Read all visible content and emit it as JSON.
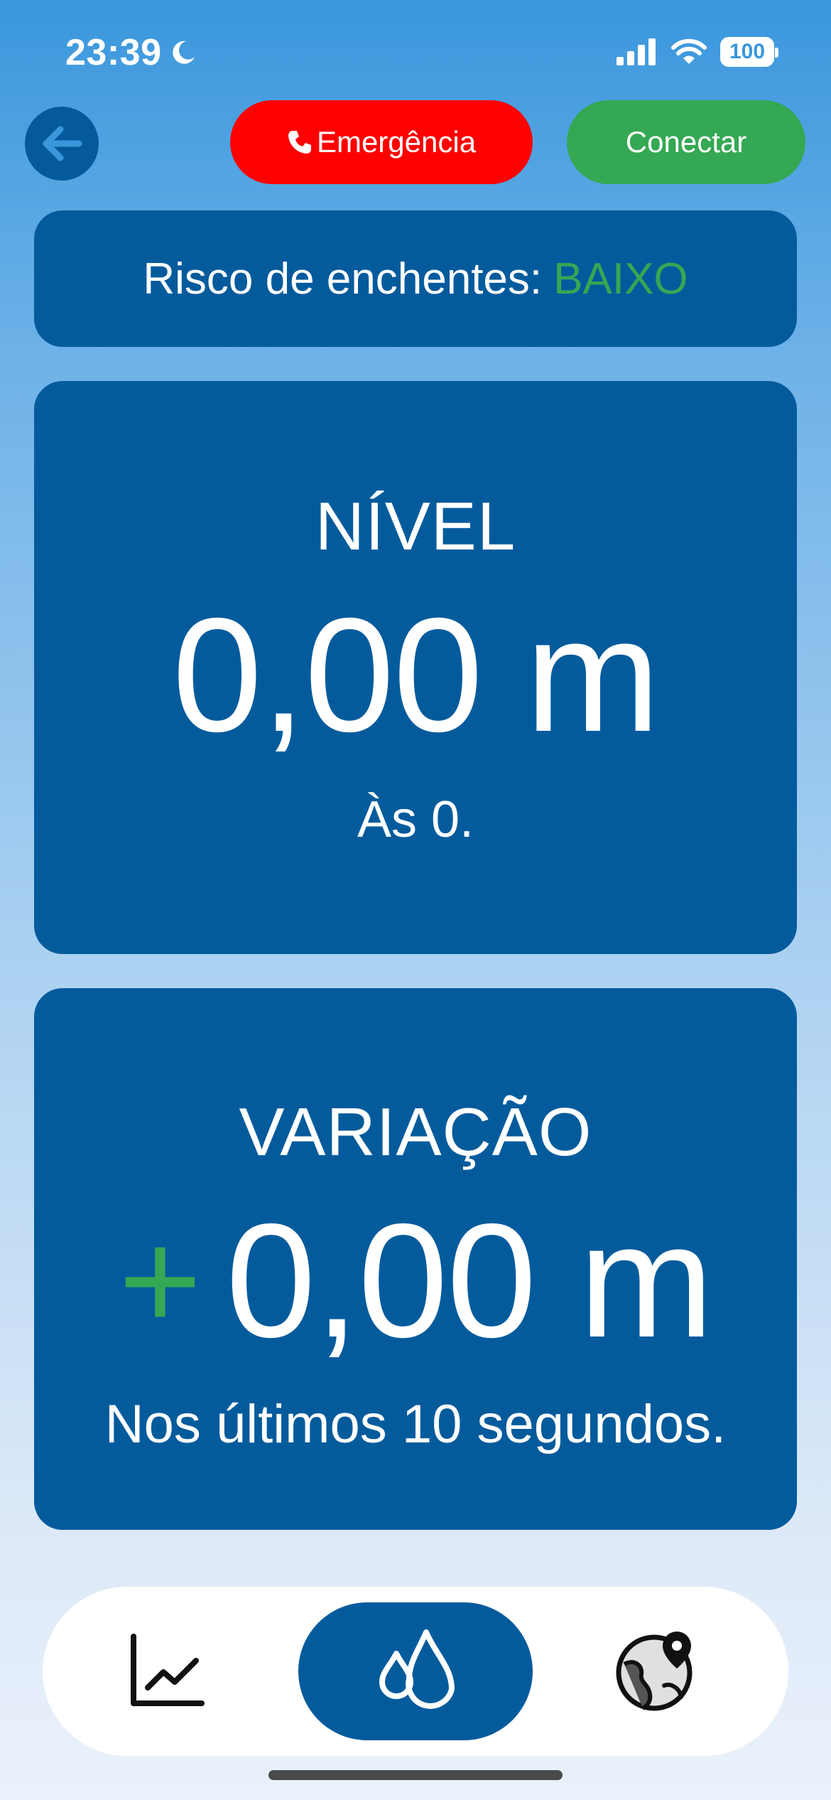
{
  "status_bar": {
    "time": "23:39",
    "battery": "100"
  },
  "header": {
    "back_icon": "arrow-left-icon",
    "emergency_label": "Emergência",
    "emergency_icon": "phone-icon",
    "connect_label": "Conectar"
  },
  "risk": {
    "label": "Risco de enchentes:",
    "value": "BAIXO",
    "value_color": "#34a853"
  },
  "level": {
    "title": "NÍVEL",
    "value": "0,00 m",
    "time": "Às 0."
  },
  "variation": {
    "title": "VARIAÇÃO",
    "sign": "+",
    "value": "0,00 m",
    "note": "Nos últimos 10 segundos."
  },
  "bottom_nav": {
    "items": [
      {
        "icon": "chart-line-icon",
        "active": false
      },
      {
        "icon": "water-drops-icon",
        "active": true
      },
      {
        "icon": "globe-pin-icon",
        "active": false
      }
    ]
  },
  "colors": {
    "primary": "#045b9c",
    "emergency": "#ff0000",
    "connect": "#34a853"
  }
}
